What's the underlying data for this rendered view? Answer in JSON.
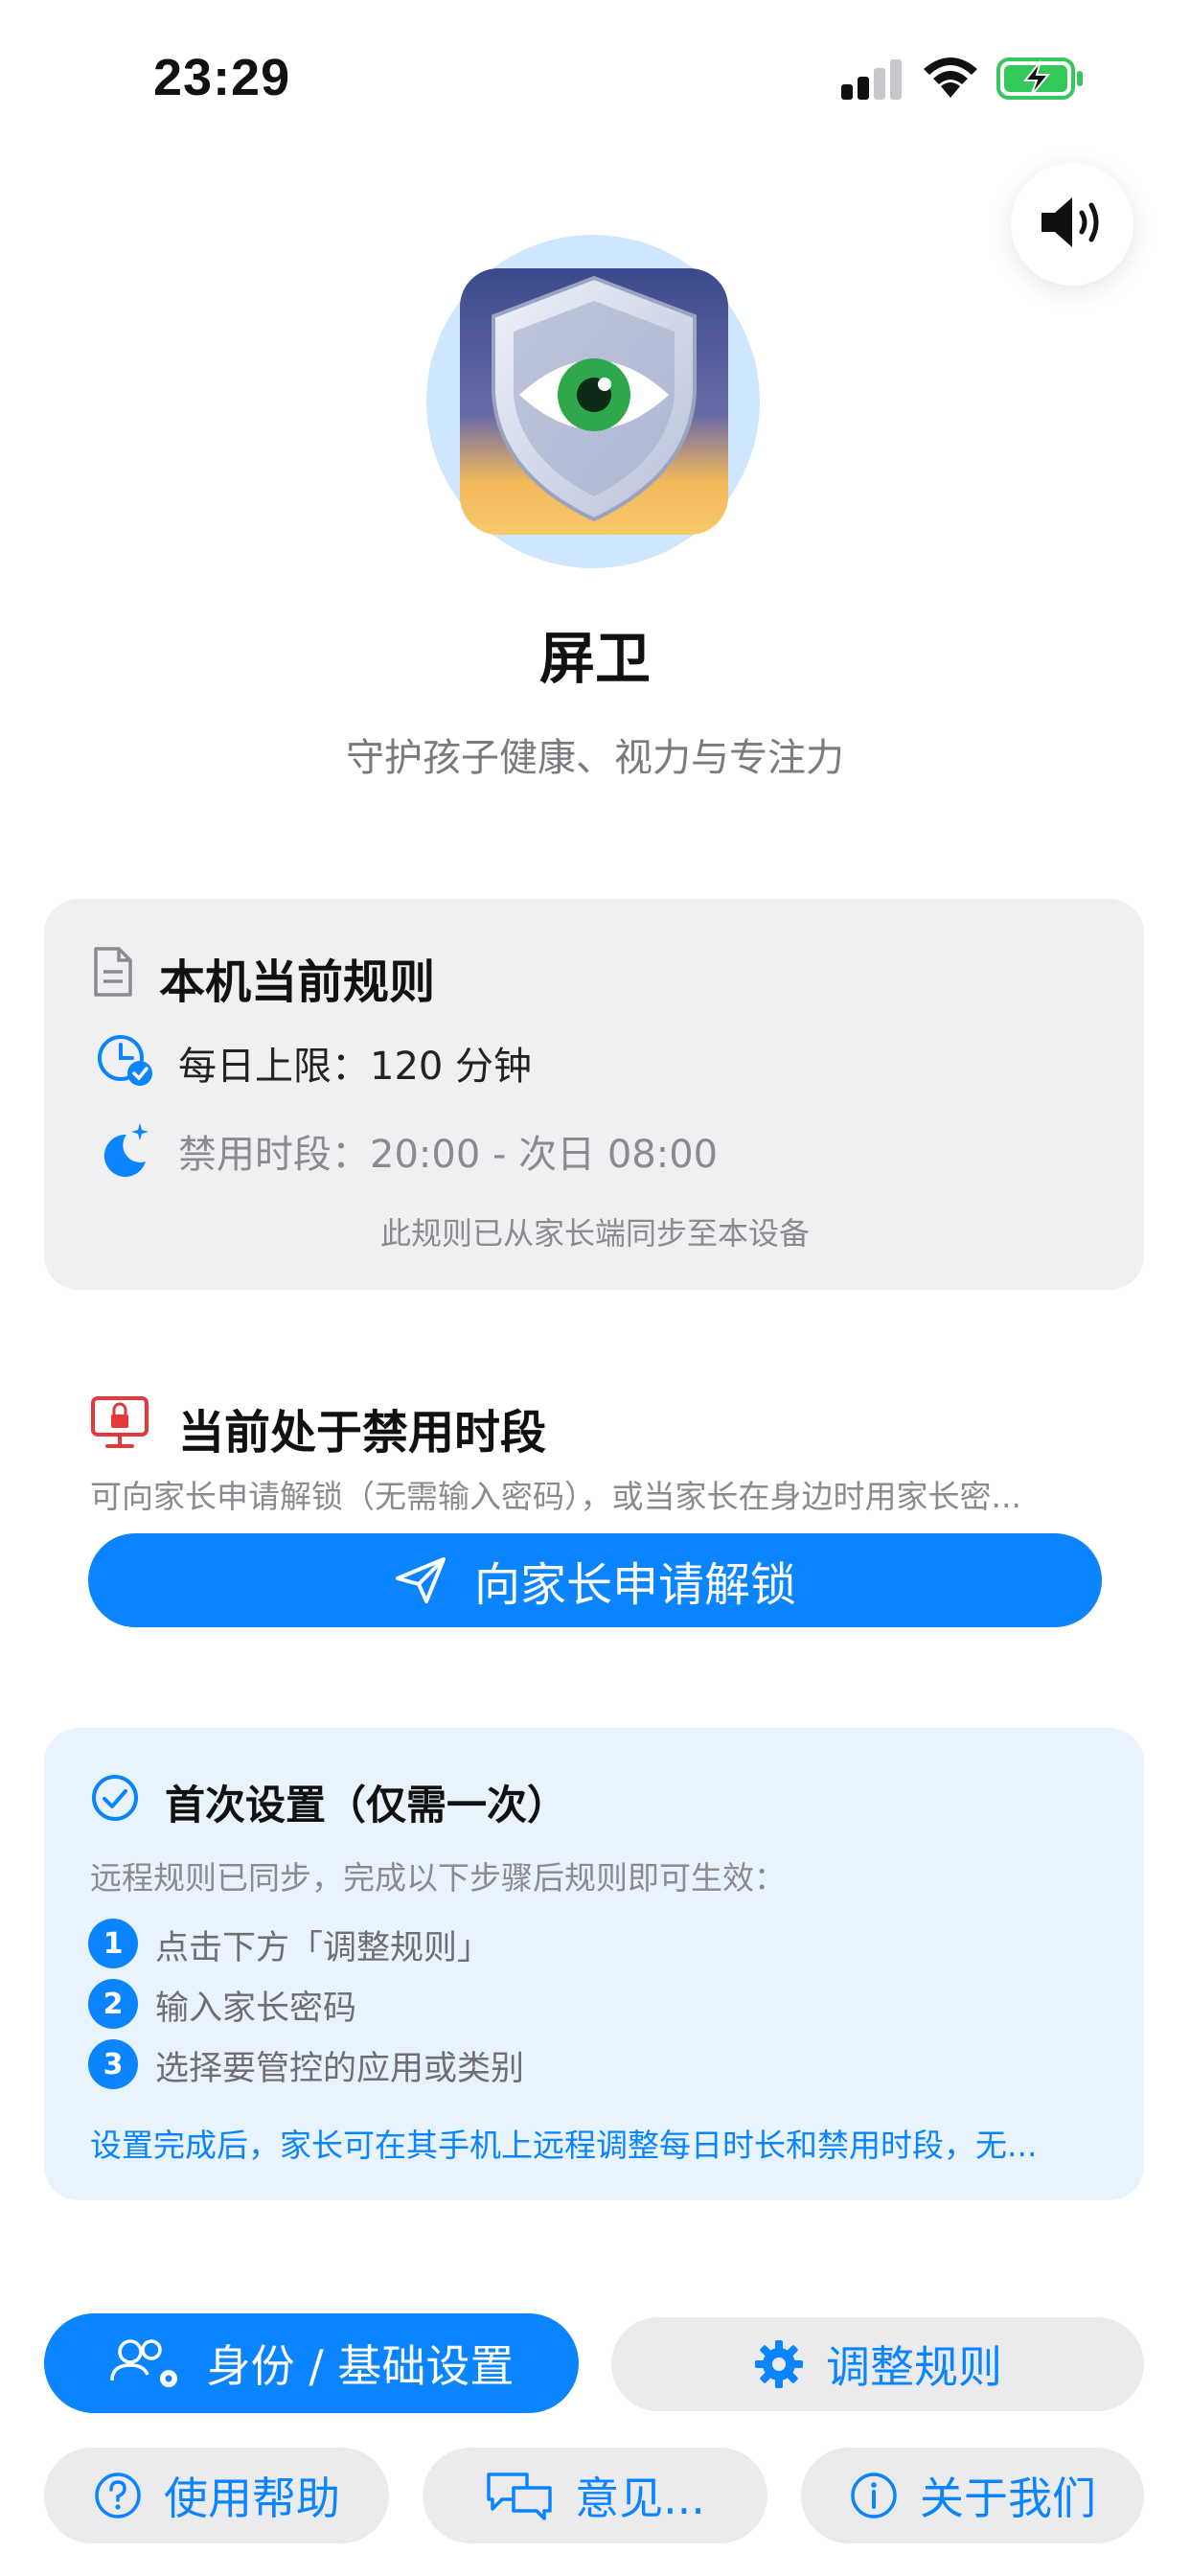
{
  "status_bar": {
    "time": "23:29"
  },
  "app": {
    "name": "屏卫",
    "subtitle": "守护孩子健康、视力与专注力"
  },
  "rules_card": {
    "title": "本机当前规则",
    "daily_limit": "每日上限：120 分钟",
    "blocked_period": "禁用时段：20:00 - 次日 08:00",
    "sync_note": "此规则已从家长端同步至本设备"
  },
  "lock_section": {
    "title": "当前处于禁用时段",
    "description": "可向家长申请解锁（无需输入密码），或当家长在身边时用家长密...",
    "unlock_button": "向家长申请解锁"
  },
  "setup_card": {
    "title": "首次设置（仅需一次）",
    "description": "远程规则已同步，完成以下步骤后规则即可生效：",
    "steps": [
      {
        "num": "1",
        "text": "点击下方「调整规则」"
      },
      {
        "num": "2",
        "text": "输入家长密码"
      },
      {
        "num": "3",
        "text": "选择要管控的应用或类别"
      }
    ],
    "note": "设置完成后，家长可在其手机上远程调整每日时长和禁用时段，无..."
  },
  "bottom_buttons": {
    "identity": "身份 / 基础设置",
    "adjust_rules": "调整规则",
    "help": "使用帮助",
    "feedback": "意见...",
    "about": "关于我们"
  },
  "colors": {
    "accent": "#0a84ff",
    "danger": "#e5383b",
    "battery": "#34c759"
  }
}
